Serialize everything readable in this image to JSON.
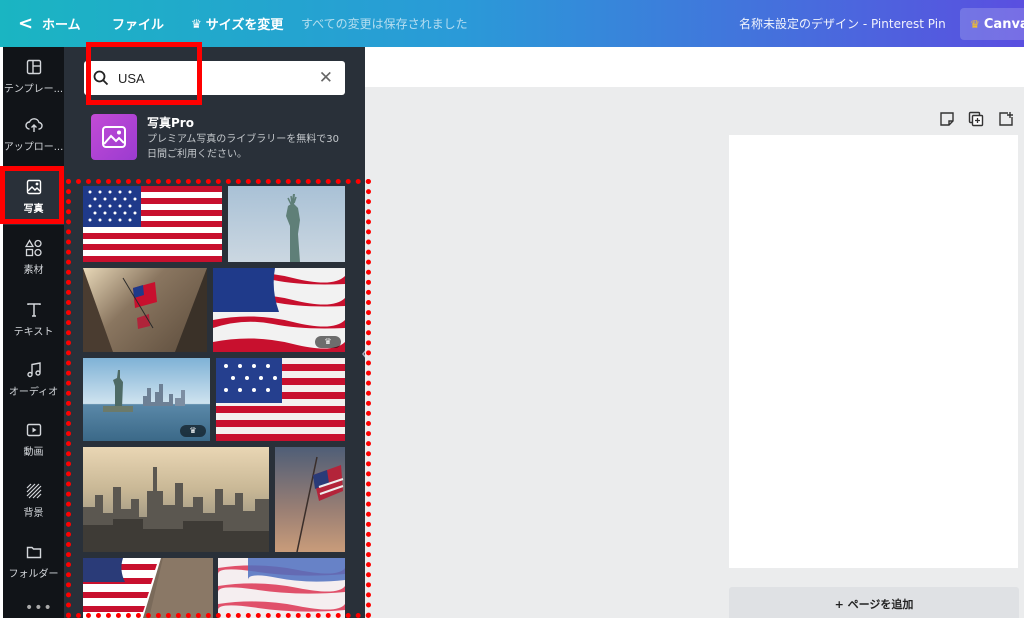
{
  "topbar": {
    "back_glyph": "<",
    "home": "ホーム",
    "file": "ファイル",
    "resize": "サイズを変更",
    "saved_status": "すべての変更は保存されました",
    "design_title": "名称未設定のデザイン - Pinterest Pin",
    "canva_pro": "Canva",
    "crown_glyph": "♛"
  },
  "rail": {
    "items": [
      {
        "label": "テンプレー..."
      },
      {
        "label": "アップロー..."
      },
      {
        "label": "写真"
      },
      {
        "label": "素材"
      },
      {
        "label": "テキスト"
      },
      {
        "label": "オーディオ"
      },
      {
        "label": "動画"
      },
      {
        "label": "背景"
      },
      {
        "label": "フォルダー"
      }
    ],
    "more": "•••"
  },
  "panel": {
    "search": {
      "value": "USA",
      "clear_glyph": "✕"
    },
    "promo": {
      "title": "写真Pro",
      "description": "プレミアム写真のライブラリーを無料で30日間ご利用ください。"
    },
    "photos": [
      {
        "name": "us-flag-flat"
      },
      {
        "name": "statue-of-liberty-sky"
      },
      {
        "name": "flag-on-building"
      },
      {
        "name": "waving-flag",
        "premium": true
      },
      {
        "name": "statue-of-liberty-harbor",
        "premium": true
      },
      {
        "name": "flag-closeup"
      },
      {
        "name": "nyc-skyline"
      },
      {
        "name": "flag-at-sunset"
      },
      {
        "name": "flag-on-wood"
      },
      {
        "name": "flag-soft"
      }
    ]
  },
  "canvas": {
    "add_page": "+ ページを追加"
  }
}
